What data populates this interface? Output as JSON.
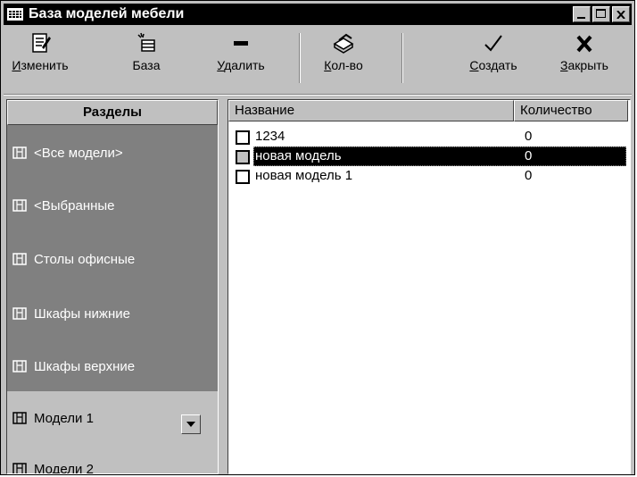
{
  "window": {
    "title": "База моделей мебели"
  },
  "toolbar": {
    "edit": {
      "label_first": "И",
      "label_rest": "зменить",
      "icon": "edit-document-icon"
    },
    "base": {
      "label": "База",
      "icon": "database-icon"
    },
    "delete": {
      "label_first": "У",
      "label_rest": "далить",
      "icon": "minus-icon"
    },
    "quantity": {
      "label_first": "К",
      "label_rest": "ол-во",
      "icon": "stack-icon"
    },
    "create": {
      "label_first": "С",
      "label_rest": "оздать",
      "icon": "checkmark-icon"
    },
    "close": {
      "label_first": "З",
      "label_rest": "акрыть",
      "icon": "x-icon"
    }
  },
  "sidebar": {
    "header": "Разделы",
    "items": [
      {
        "label": "<Все модели>"
      },
      {
        "label": "<Выбранные"
      },
      {
        "label": "Столы офисные"
      },
      {
        "label": "Шкафы нижние"
      },
      {
        "label": "Шкафы верхние"
      },
      {
        "label": "Модели 1",
        "selected": true
      },
      {
        "label": "Модели 2"
      }
    ]
  },
  "list": {
    "columns": [
      "Название",
      "Количество"
    ],
    "rows": [
      {
        "name": "1234",
        "qty": "0",
        "selected": false
      },
      {
        "name": "новая модель",
        "qty": "0",
        "selected": true
      },
      {
        "name": "новая модель 1",
        "qty": "0",
        "selected": false
      }
    ]
  }
}
